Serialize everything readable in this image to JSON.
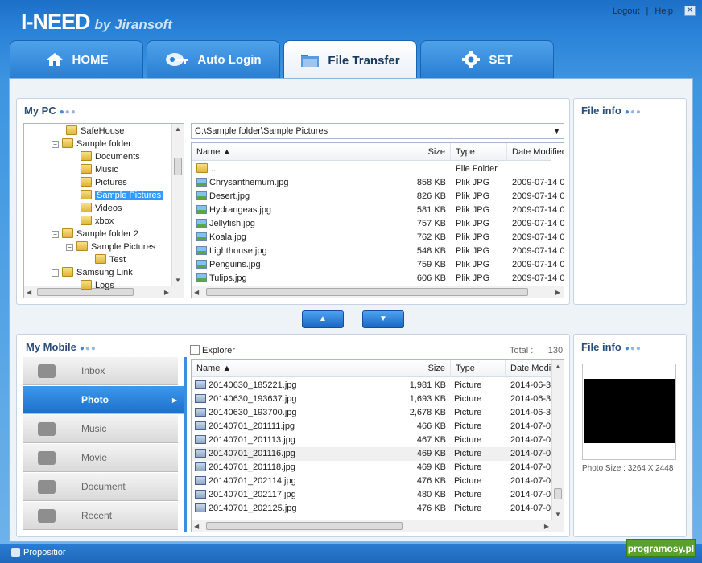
{
  "app": {
    "logo_main": "I-NEED",
    "logo_by": "by Jiransoft",
    "logout": "Logout",
    "separator": "|",
    "help": "Help",
    "close_glyph": "✕"
  },
  "tabs": [
    {
      "label": "HOME",
      "icon": "home-icon"
    },
    {
      "label": "Auto Login",
      "icon": "key-icon"
    },
    {
      "label": "File Transfer",
      "icon": "folder-icon"
    },
    {
      "label": "SET",
      "icon": "gear-icon"
    }
  ],
  "mypc": {
    "title": "My PC",
    "tree": [
      {
        "label": "SafeHouse",
        "indent": 2,
        "expander": ""
      },
      {
        "label": "Sample folder",
        "indent": 1,
        "expander": "−"
      },
      {
        "label": "Documents",
        "indent": 3,
        "expander": ""
      },
      {
        "label": "Music",
        "indent": 3,
        "expander": ""
      },
      {
        "label": "Pictures",
        "indent": 3,
        "expander": ""
      },
      {
        "label": "Sample Pictures",
        "indent": 3,
        "expander": "",
        "selected": true
      },
      {
        "label": "Videos",
        "indent": 3,
        "expander": ""
      },
      {
        "label": "xbox",
        "indent": 3,
        "expander": ""
      },
      {
        "label": "Sample folder 2",
        "indent": 1,
        "expander": "−"
      },
      {
        "label": "Sample Pictures",
        "indent": 2,
        "expander": "−"
      },
      {
        "label": "Test",
        "indent": 4,
        "expander": ""
      },
      {
        "label": "Samsung Link",
        "indent": 1,
        "expander": "−"
      },
      {
        "label": "Logs",
        "indent": 3,
        "expander": ""
      }
    ],
    "path": "C:\\Sample folder\\Sample Pictures",
    "columns": {
      "name": "Name",
      "size": "Size",
      "type": "Type",
      "date": "Date Modified"
    },
    "files": [
      {
        "name": "..",
        "size": "",
        "type": "File Folder",
        "date": "",
        "icon": "folder"
      },
      {
        "name": "Chrysanthemum.jpg",
        "size": "858 KB",
        "type": "Plik JPG",
        "date": "2009-07-14 0",
        "icon": "image"
      },
      {
        "name": "Desert.jpg",
        "size": "826 KB",
        "type": "Plik JPG",
        "date": "2009-07-14 0",
        "icon": "image"
      },
      {
        "name": "Hydrangeas.jpg",
        "size": "581 KB",
        "type": "Plik JPG",
        "date": "2009-07-14 0",
        "icon": "image"
      },
      {
        "name": "Jellyfish.jpg",
        "size": "757 KB",
        "type": "Plik JPG",
        "date": "2009-07-14 0",
        "icon": "image"
      },
      {
        "name": "Koala.jpg",
        "size": "762 KB",
        "type": "Plik JPG",
        "date": "2009-07-14 0",
        "icon": "image"
      },
      {
        "name": "Lighthouse.jpg",
        "size": "548 KB",
        "type": "Plik JPG",
        "date": "2009-07-14 0",
        "icon": "image"
      },
      {
        "name": "Penguins.jpg",
        "size": "759 KB",
        "type": "Plik JPG",
        "date": "2009-07-14 0",
        "icon": "image"
      },
      {
        "name": "Tulips.jpg",
        "size": "606 KB",
        "type": "Plik JPG",
        "date": "2009-07-14 0",
        "icon": "image"
      }
    ]
  },
  "fileinfo_top": {
    "title": "File info"
  },
  "transfer": {
    "up": "▲",
    "down": "▼"
  },
  "mymobile": {
    "title": "My Mobile",
    "explorer": "Explorer",
    "total_label": "Total :",
    "total_value": "130",
    "categories": [
      {
        "label": "Inbox",
        "icon": "inbox-icon"
      },
      {
        "label": "Photo",
        "icon": "photo-icon",
        "active": true
      },
      {
        "label": "Music",
        "icon": "headphones-icon"
      },
      {
        "label": "Movie",
        "icon": "camera-icon"
      },
      {
        "label": "Document",
        "icon": "document-icon"
      },
      {
        "label": "Recent",
        "icon": "clock-icon"
      }
    ],
    "columns": {
      "name": "Name",
      "size": "Size",
      "type": "Type",
      "date": "Date Modi"
    },
    "files": [
      {
        "name": "20140630_185221.jpg",
        "size": "1,981 KB",
        "type": "Picture",
        "date": "2014-06-3"
      },
      {
        "name": "20140630_193637.jpg",
        "size": "1,693 KB",
        "type": "Picture",
        "date": "2014-06-3"
      },
      {
        "name": "20140630_193700.jpg",
        "size": "2,678 KB",
        "type": "Picture",
        "date": "2014-06-3"
      },
      {
        "name": "20140701_201111.jpg",
        "size": "466 KB",
        "type": "Picture",
        "date": "2014-07-0"
      },
      {
        "name": "20140701_201113.jpg",
        "size": "467 KB",
        "type": "Picture",
        "date": "2014-07-0"
      },
      {
        "name": "20140701_201116.jpg",
        "size": "469 KB",
        "type": "Picture",
        "date": "2014-07-0",
        "highlight": true
      },
      {
        "name": "20140701_201118.jpg",
        "size": "469 KB",
        "type": "Picture",
        "date": "2014-07-0"
      },
      {
        "name": "20140701_202114.jpg",
        "size": "476 KB",
        "type": "Picture",
        "date": "2014-07-0"
      },
      {
        "name": "20140701_202117.jpg",
        "size": "480 KB",
        "type": "Picture",
        "date": "2014-07-0"
      },
      {
        "name": "20140701_202125.jpg",
        "size": "476 KB",
        "type": "Picture",
        "date": "2014-07-0"
      }
    ]
  },
  "fileinfo_bottom": {
    "title": "File info",
    "photo_size": "Photo Size : 3264 X 2448"
  },
  "footer": {
    "proposition": "Propositior",
    "watermark": "programosy.pl"
  },
  "colors": {
    "accent": "#2a7ed3",
    "selection": "#3399ff"
  }
}
